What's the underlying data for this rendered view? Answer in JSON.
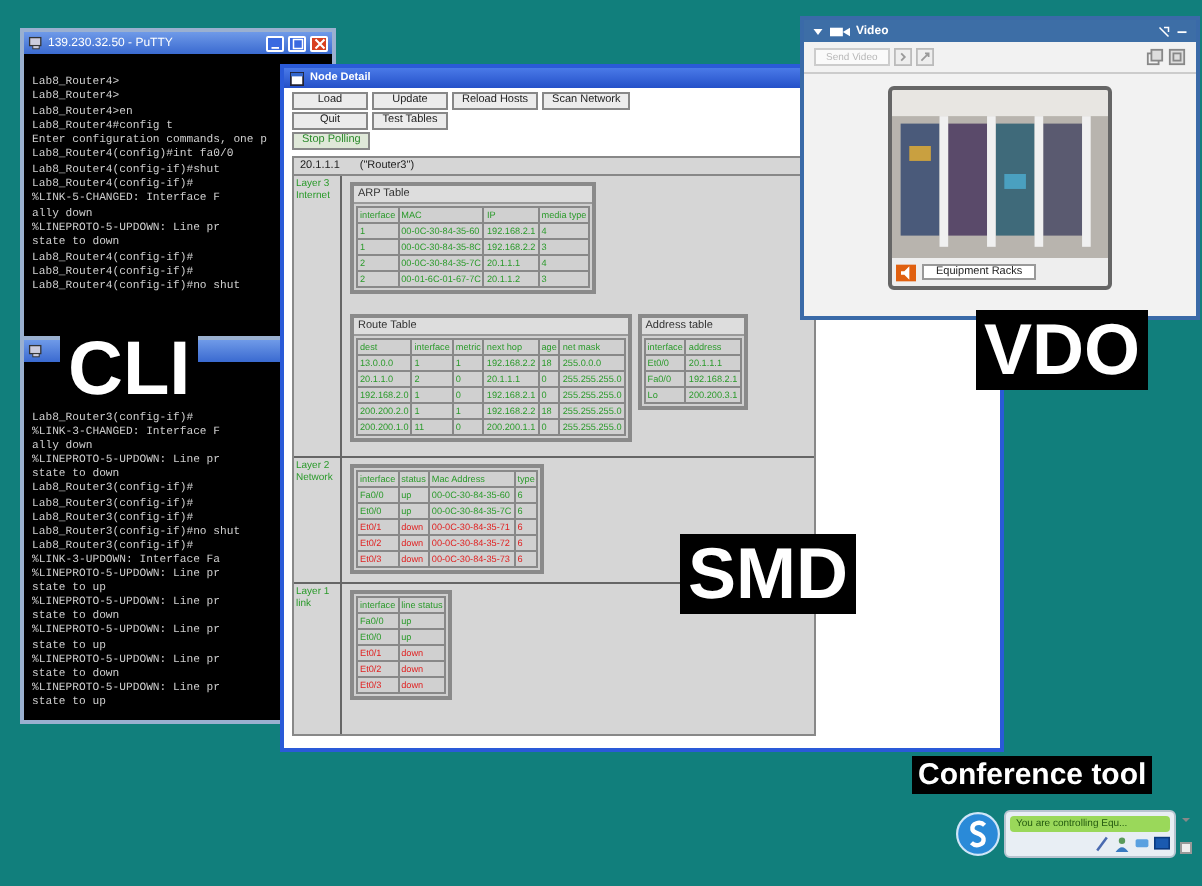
{
  "terminals": [
    {
      "title": "139.230.32.50 - PuTTY",
      "lines": [
        "Lab8_Router4>",
        "Lab8_Router4>",
        "Lab8_Router4>en",
        "Lab8_Router4#config t",
        "Enter configuration commands, one p",
        "Lab8_Router4(config)#int fa0/0",
        "Lab8_Router4(config-if)#shut",
        "Lab8_Router4(config-if)#",
        "%LINK-5-CHANGED: Interface F",
        "ally down",
        "%LINEPROTO-5-UPDOWN: Line pr",
        "state to down",
        "Lab8_Router4(config-if)#",
        "Lab8_Router4(config-if)#",
        "Lab8_Router4(config-if)#no shut"
      ]
    },
    {
      "lines": [
        "Lab8_Router3(config-if)#",
        "%LINK-3-CHANGED: Interface F",
        "ally down",
        "%LINEPROTO-5-UPDOWN: Line pr",
        "state to down",
        "Lab8_Router3(config-if)#",
        "Lab8_Router3(config-if)#",
        "Lab8_Router3(config-if)#",
        "Lab8_Router3(config-if)#no shut",
        "Lab8_Router3(config-if)#",
        "%LINK-3-UPDOWN: Interface Fa",
        "%LINEPROTO-5-UPDOWN: Line pr",
        "state to up",
        "%LINEPROTO-5-UPDOWN: Line pr",
        "state to down",
        "%LINEPROTO-5-UPDOWN: Line pr",
        "state to up",
        "%LINEPROTO-5-UPDOWN: Line pr",
        "state to down",
        "%LINEPROTO-5-UPDOWN: Line pr",
        "state to up"
      ]
    }
  ],
  "node_window": {
    "title": "Node Detail",
    "button_rows": [
      [
        {
          "label": "Load",
          "kind": "normal"
        },
        {
          "label": "Update",
          "kind": "normal"
        },
        {
          "label": "Reload Hosts",
          "kind": "normal"
        },
        {
          "label": "Scan Network",
          "kind": "normal"
        }
      ],
      [
        {
          "label": "Quit",
          "kind": "normal"
        },
        {
          "label": "Test Tables",
          "kind": "normal"
        }
      ],
      [
        {
          "label": "Stop Polling",
          "kind": "active"
        }
      ]
    ],
    "node_address": "20.1.1.1",
    "node_name": "(\"Router3\")",
    "layers": [
      {
        "label": "Layer 3 Internet",
        "tables": [
          {
            "title": "ARP Table",
            "columns": [
              "interface",
              "MAC",
              "IP",
              "media type"
            ],
            "rows": [
              {
                "cells": [
                  "1",
                  "00-0C-30-84-35-60",
                  "192.168.2.1",
                  "4"
                ],
                "alert": false
              },
              {
                "cells": [
                  "1",
                  "00-0C-30-84-35-8C",
                  "192.168.2.2",
                  "3"
                ],
                "alert": false
              },
              {
                "cells": [
                  "2",
                  "00-0C-30-84-35-7C",
                  "20.1.1.1",
                  "4"
                ],
                "alert": false
              },
              {
                "cells": [
                  "2",
                  "00-01-6C-01-67-7C",
                  "20.1.1.2",
                  "3"
                ],
                "alert": false
              }
            ]
          },
          {
            "title": "Route Table",
            "columns": [
              "dest",
              "interface",
              "metric",
              "next hop",
              "age",
              "net mask"
            ],
            "rows": [
              {
                "cells": [
                  "13.0.0.0",
                  "1",
                  "1",
                  "192.168.2.2",
                  "18",
                  "255.0.0.0"
                ],
                "alert": false
              },
              {
                "cells": [
                  "20.1.1.0",
                  "2",
                  "0",
                  "20.1.1.1",
                  "0",
                  "255.255.255.0"
                ],
                "alert": false
              },
              {
                "cells": [
                  "192.168.2.0",
                  "1",
                  "0",
                  "192.168.2.1",
                  "0",
                  "255.255.255.0"
                ],
                "alert": false
              },
              {
                "cells": [
                  "200.200.2.0",
                  "1",
                  "1",
                  "192.168.2.2",
                  "18",
                  "255.255.255.0"
                ],
                "alert": false
              },
              {
                "cells": [
                  "200.200.1.0",
                  "11",
                  "0",
                  "200.200.1.1",
                  "0",
                  "255.255.255.0"
                ],
                "alert": false
              }
            ]
          },
          {
            "title": "Address table",
            "columns": [
              "interface",
              "address"
            ],
            "rows": [
              {
                "cells": [
                  "Et0/0",
                  "20.1.1.1"
                ],
                "alert": false
              },
              {
                "cells": [
                  "Fa0/0",
                  "192.168.2.1"
                ],
                "alert": false
              },
              {
                "cells": [
                  "Lo",
                  "200.200.3.1"
                ],
                "alert": false
              }
            ]
          }
        ]
      },
      {
        "label": "Layer 2 Network",
        "tables": [
          {
            "columns": [
              "interface",
              "status",
              "Mac Address",
              "type"
            ],
            "rows": [
              {
                "cells": [
                  "Fa0/0",
                  "up",
                  "00-0C-30-84-35-60",
                  "6"
                ],
                "alert": false
              },
              {
                "cells": [
                  "Et0/0",
                  "up",
                  "00-0C-30-84-35-7C",
                  "6"
                ],
                "alert": false
              },
              {
                "cells": [
                  "Et0/1",
                  "down",
                  "00-0C-30-84-35-71",
                  "6"
                ],
                "alert": true
              },
              {
                "cells": [
                  "Et0/2",
                  "down",
                  "00-0C-30-84-35-72",
                  "6"
                ],
                "alert": true
              },
              {
                "cells": [
                  "Et0/3",
                  "down",
                  "00-0C-30-84-35-73",
                  "6"
                ],
                "alert": true
              }
            ]
          }
        ]
      },
      {
        "label": "Layer 1 link",
        "tables": [
          {
            "columns": [
              "interface",
              "line status"
            ],
            "rows": [
              {
                "cells": [
                  "Fa0/0",
                  "up"
                ],
                "alert": false
              },
              {
                "cells": [
                  "Et0/0",
                  "up"
                ],
                "alert": false
              },
              {
                "cells": [
                  "Et0/1",
                  "down"
                ],
                "alert": true
              },
              {
                "cells": [
                  "Et0/2",
                  "down"
                ],
                "alert": true
              },
              {
                "cells": [
                  "Et0/3",
                  "down"
                ],
                "alert": true
              }
            ]
          }
        ]
      }
    ]
  },
  "video_window": {
    "title": "Video",
    "send_button": {
      "label": "Send Video",
      "disabled": true
    },
    "caption": "Equipment Racks"
  },
  "callouts": [
    "CLI",
    "VDO",
    "SMD",
    "Conference tool"
  ],
  "conference": {
    "status": "You are controlling Equ..."
  }
}
